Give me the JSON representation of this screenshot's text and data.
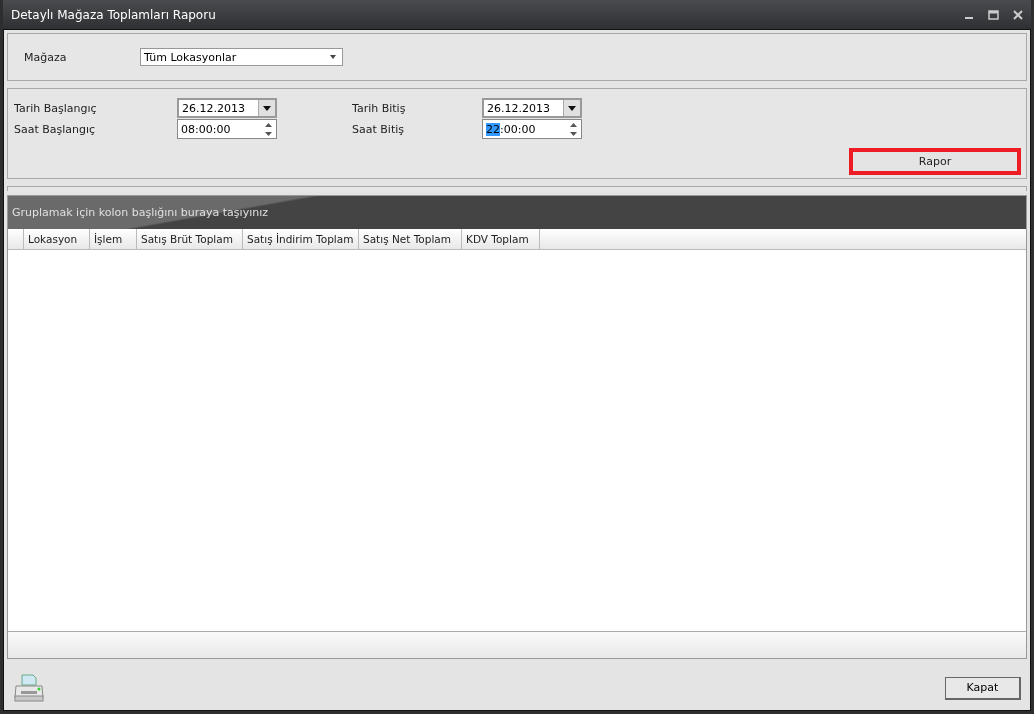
{
  "window": {
    "title": "Detaylı Mağaza Toplamları Raporu"
  },
  "store": {
    "label": "Mağaza",
    "value": "Tüm Lokasyonlar"
  },
  "start_date": {
    "label": "Tarih Başlangıç",
    "value": "26.12.2013"
  },
  "start_time": {
    "label": "Saat Başlangıç",
    "value": "08:00:00",
    "focused": false
  },
  "end_date": {
    "label": "Tarih Bitiş",
    "value": "26.12.2013"
  },
  "end_time": {
    "label": "Saat Bitiş",
    "value": "22:00:00",
    "focused": true
  },
  "report_button": {
    "label": "Rapor",
    "highlighted": true
  },
  "grid": {
    "group_hint": "Gruplamak için kolon başlığını buraya taşıyınız",
    "columns": [
      "Lokasyon",
      "İşlem",
      "Satış Brüt Toplam",
      "Satış İndirim Toplam",
      "Satış Net Toplam",
      "KDV Toplam"
    ]
  },
  "close_button": {
    "label": "Kapat"
  }
}
